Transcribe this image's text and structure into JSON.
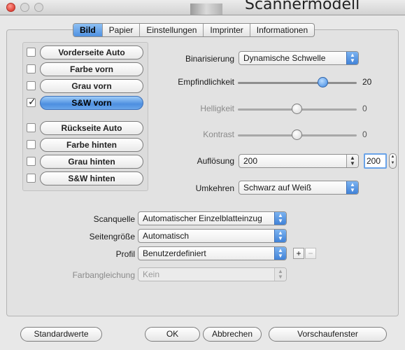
{
  "window": {
    "title": "Scannermodell"
  },
  "tabs": [
    {
      "label": "Bild",
      "active": true
    },
    {
      "label": "Papier",
      "active": false
    },
    {
      "label": "Einstellungen",
      "active": false
    },
    {
      "label": "Imprinter",
      "active": false
    },
    {
      "label": "Informationen",
      "active": false
    }
  ],
  "image_types": [
    {
      "label": "Vorderseite Auto",
      "checked": false,
      "selected": false
    },
    {
      "label": "Farbe vorn",
      "checked": false,
      "selected": false
    },
    {
      "label": "Grau vorn",
      "checked": false,
      "selected": false
    },
    {
      "label": "S&W vorn",
      "checked": true,
      "selected": true
    },
    {
      "label": "Rückseite Auto",
      "checked": false,
      "selected": false
    },
    {
      "label": "Farbe hinten",
      "checked": false,
      "selected": false
    },
    {
      "label": "Grau hinten",
      "checked": false,
      "selected": false
    },
    {
      "label": "S&W hinten",
      "checked": false,
      "selected": false
    }
  ],
  "binarisierung": {
    "label": "Binarisierung",
    "value": "Dynamische Schwelle"
  },
  "empfindlichkeit": {
    "label": "Empfindlichkeit",
    "value": "20",
    "level": 0.72
  },
  "helligkeit": {
    "label": "Helligkeit",
    "value": "0",
    "level": 0.5
  },
  "kontrast": {
    "label": "Kontrast",
    "value": "0",
    "level": 0.5
  },
  "aufloesung": {
    "label": "Auflösung",
    "value": "200",
    "field": "200"
  },
  "umkehren": {
    "label": "Umkehren",
    "value": "Schwarz auf Weiß"
  },
  "scanquelle": {
    "label": "Scanquelle",
    "value": "Automatischer Einzelblatteinzug"
  },
  "seitengroesse": {
    "label": "Seitengröße",
    "value": "Automatisch"
  },
  "profil": {
    "label": "Profil",
    "value": "Benutzerdefiniert",
    "add": "+",
    "remove": "−"
  },
  "farbangleichung": {
    "label": "Farbangleichung",
    "value": "Kein"
  },
  "buttons": {
    "defaults": "Standardwerte",
    "ok": "OK",
    "cancel": "Abbrechen",
    "preview": "Vorschaufenster"
  },
  "icons": {
    "close": "close-button-icon",
    "select_arrow": "up-down-arrows-icon",
    "check": "checkmark-icon"
  }
}
